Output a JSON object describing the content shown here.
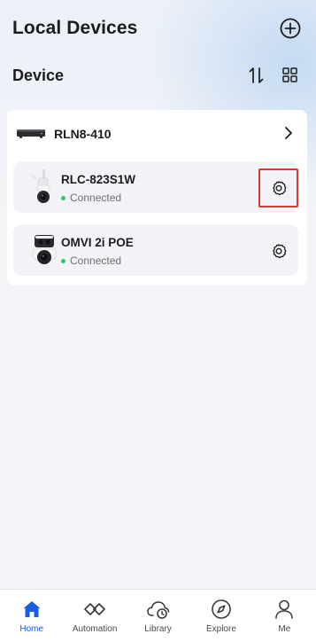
{
  "header": {
    "title": "Local Devices"
  },
  "section": {
    "title": "Device"
  },
  "nvr": {
    "name": "RLN8-410"
  },
  "cameras": [
    {
      "name": "RLC-823S1W",
      "status": "Connected",
      "settings_highlighted": true
    },
    {
      "name": "OMVI 2i POE",
      "status": "Connected",
      "settings_highlighted": false
    }
  ],
  "tabs": [
    {
      "label": "Home",
      "icon": "home-icon",
      "active": true
    },
    {
      "label": "Automation",
      "icon": "automation-icon",
      "active": false
    },
    {
      "label": "Library",
      "icon": "library-cloud-icon",
      "active": false
    },
    {
      "label": "Explore",
      "icon": "compass-icon",
      "active": false
    },
    {
      "label": "Me",
      "icon": "person-icon",
      "active": false
    }
  ],
  "colors": {
    "accent": "#1b5fe0",
    "status_connected": "#34c759",
    "highlight_border": "#e0362e"
  }
}
